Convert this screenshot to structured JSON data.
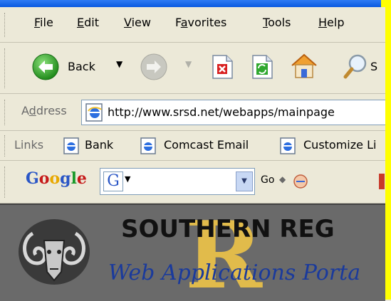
{
  "menu": {
    "items": [
      {
        "label": "File",
        "underline": "F"
      },
      {
        "label": "Edit",
        "underline": "E"
      },
      {
        "label": "View",
        "underline": "V"
      },
      {
        "label": "Favorites",
        "underline": "a"
      },
      {
        "label": "Tools",
        "underline": "T"
      },
      {
        "label": "Help",
        "underline": "H"
      }
    ]
  },
  "toolbar": {
    "back_label": "Back",
    "search_partial": "S"
  },
  "address": {
    "label": "Address",
    "url": "http://www.srsd.net/webapps/mainpage"
  },
  "links": {
    "label": "Links",
    "items": [
      "Bank",
      "Comcast Email",
      "Customize Li"
    ]
  },
  "google": {
    "logo": "Google",
    "go_label": "Go"
  },
  "page": {
    "school_name": "SOUTHERN REG",
    "subtitle": "Web Applications Porta",
    "watermark": "R A"
  },
  "colors": {
    "toolbar_bg": "#ece9d8",
    "titlebar": "#0a5ae0",
    "content_bg": "#6a6a6a",
    "subtitle": "#1a3a9c",
    "watermark": "#e8c04a",
    "edge_strip": "#ffff00"
  }
}
